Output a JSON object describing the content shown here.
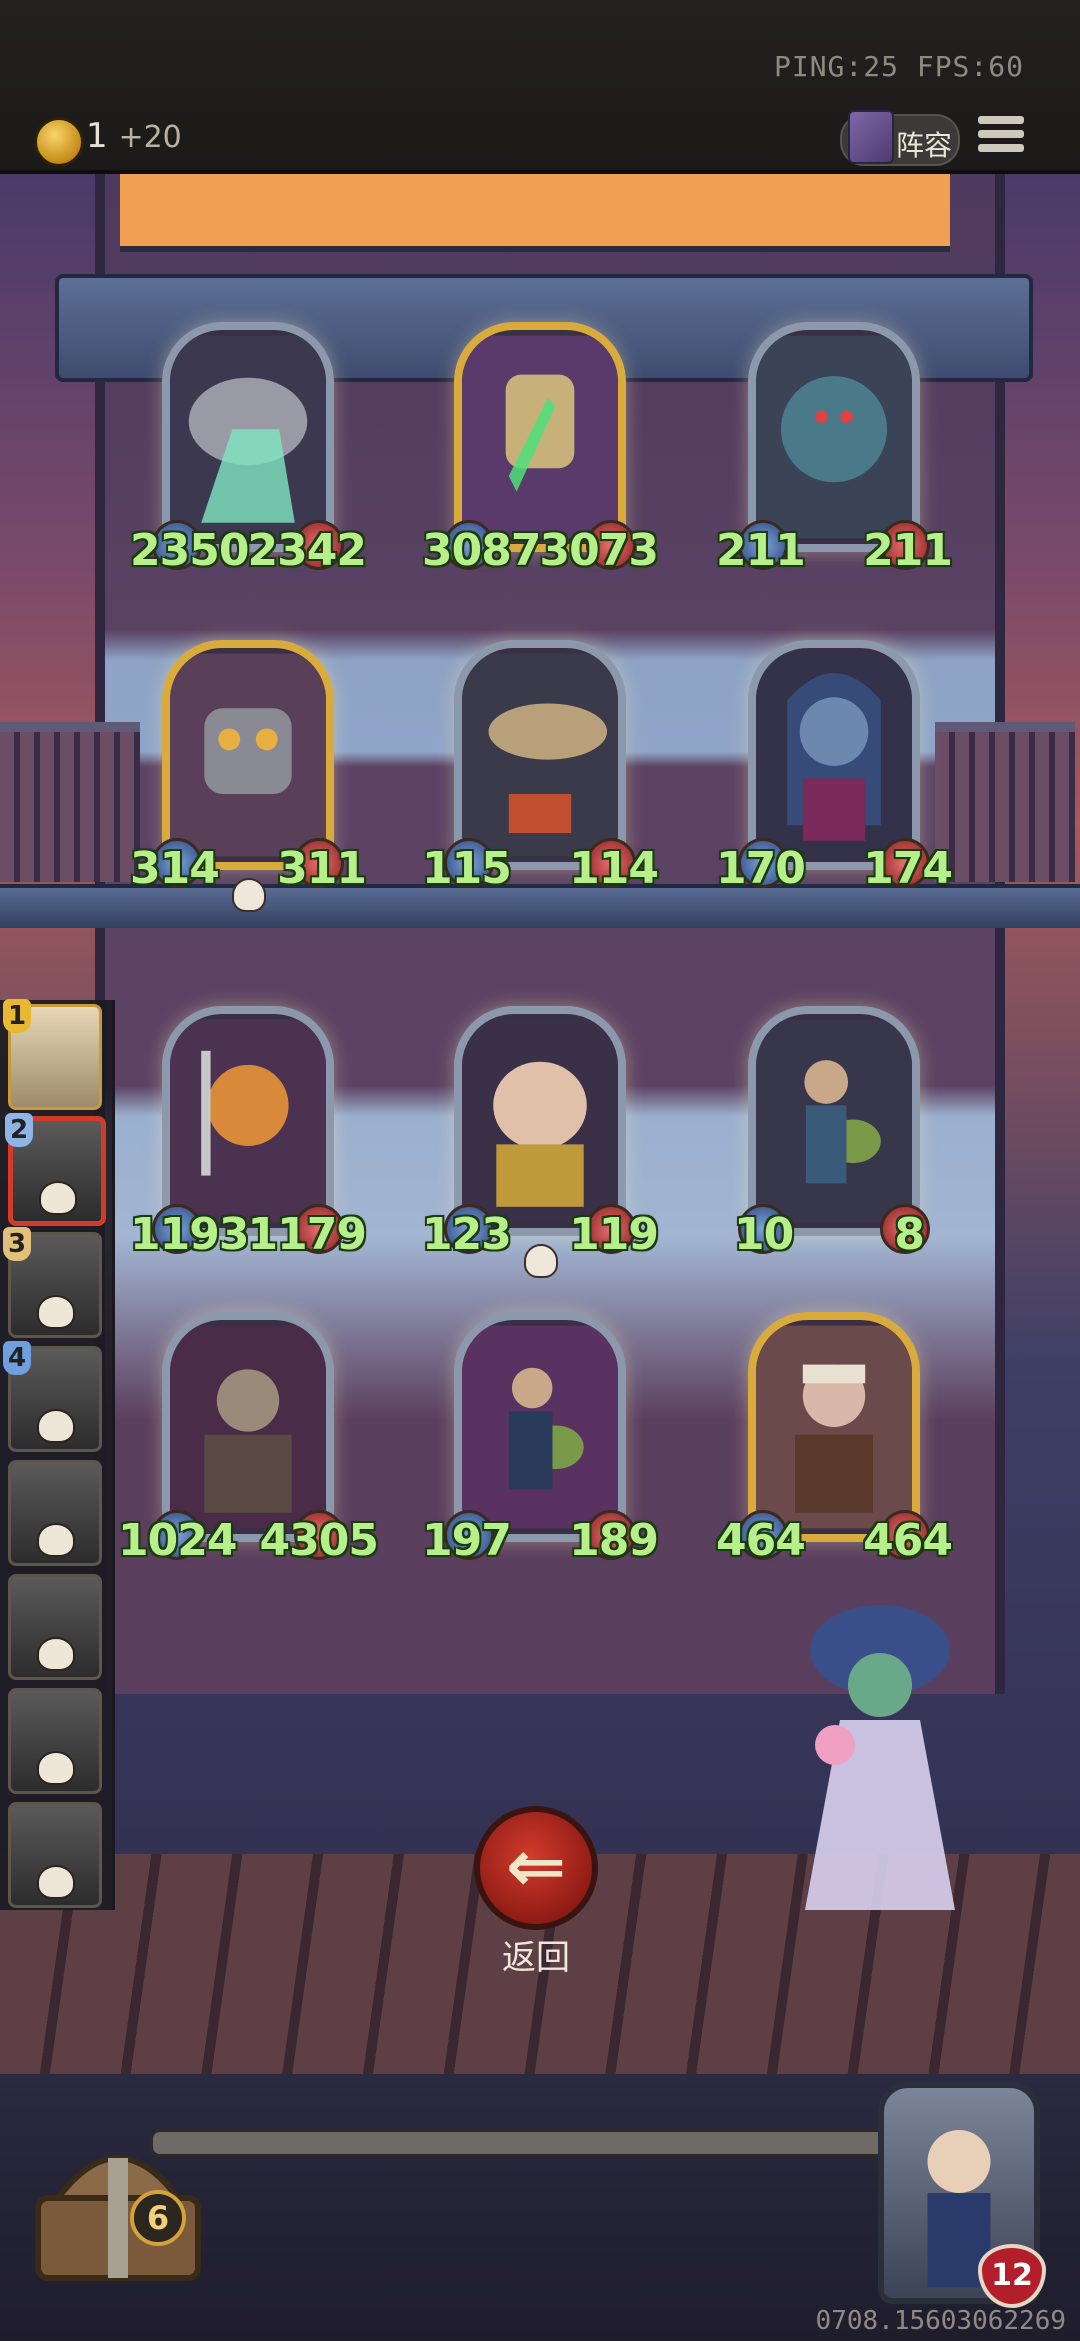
{
  "header": {
    "ping_text": "PING:25   FPS:60",
    "gold": "1",
    "gold_income": "+20",
    "lineup_label": "阵容"
  },
  "board": {
    "row1": [
      {
        "atk": "2350",
        "hp": "2342"
      },
      {
        "atk": "3087",
        "hp": "3073"
      },
      {
        "atk": "211",
        "hp": "211"
      }
    ],
    "row2": [
      {
        "atk": "314",
        "hp": "311"
      },
      {
        "atk": "115",
        "hp": "114"
      },
      {
        "atk": "170",
        "hp": "174"
      }
    ],
    "row3": [
      {
        "atk": "1193",
        "hp": "1179"
      },
      {
        "atk": "123",
        "hp": "119"
      },
      {
        "atk": "10",
        "hp": "8"
      }
    ],
    "row4": [
      {
        "atk": "1024",
        "hp": "4305"
      },
      {
        "atk": "197",
        "hp": "189"
      },
      {
        "atk": "464",
        "hp": "464"
      }
    ]
  },
  "players": [
    "1",
    "2",
    "3",
    "4"
  ],
  "back_label": "返回",
  "chest_count": "6",
  "player_health": "12",
  "build_id": "0708.15603062269",
  "colors": {
    "stat_green": "#b7f08a",
    "back_red": "#d33b2c",
    "gold_frame": "#d8ab3c"
  }
}
